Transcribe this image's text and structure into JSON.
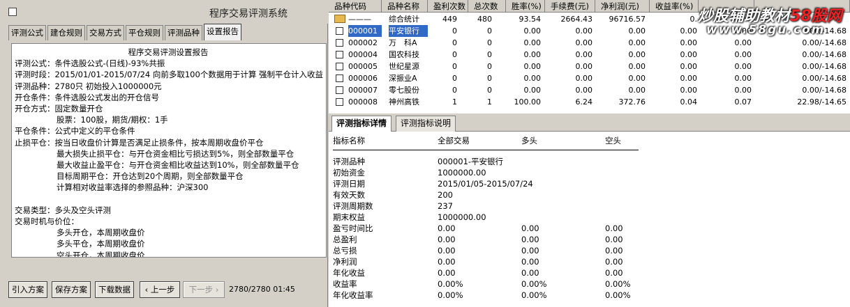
{
  "window": {
    "title": "程序交易评测系统"
  },
  "tabs": [
    "评测公式",
    "建仓规则",
    "交易方式",
    "平仓规则",
    "评测品种",
    "设置报告"
  ],
  "report": {
    "title": "程序交易评测设置报告",
    "lines": [
      "评测公式：条件选股公式-(日线)-93%共振",
      "评测时段：2015/01/01-2015/07/24 向前多取100个数据用于计算 强制平仓计入收益",
      "评测品种：2780只 初始投入1000000元",
      "开仓条件：条件选股公式发出的开仓信号",
      "开仓方式：固定数量开仓",
      "股票：100股，期货/期权：1手",
      "平仓条件：公式中定义的平仓条件",
      "止损平仓：按当日收盘价计算是否满足止损条件，按本周期收盘价平仓",
      "最大损失止损平仓：与开仓资金相比亏损达到5%，则全部数量平仓",
      "最大收益止盈平仓：与开仓资金相比收益达到10%，则全部数量平仓",
      "目标周期平仓：开仓达到20个周期，则全部数量平仓",
      "计算相对收益率选择的参照品种：沪深300",
      "",
      "交易类型：多头及空头评测",
      "交易时机与价位：",
      "多头开仓，本周期收盘价",
      "多头平仓，本周期收盘价",
      "空头开仓，本周期收盘价"
    ]
  },
  "buttons": {
    "import": "引入方案",
    "save": "保存方案",
    "download": "下载数据",
    "prev": "上一步",
    "next": "下一步"
  },
  "status": "2780/2780  01:45",
  "grid": {
    "headers": [
      "品种代码",
      "品种名称",
      "盈利次数",
      "总次数",
      "胜率(%)",
      "手续费(元)",
      "净利润(元)",
      "收益率(%)",
      "",
      ""
    ],
    "rows": [
      {
        "code": "———",
        "name": "综合统计",
        "win": "449",
        "total": "480",
        "rate": "93.54",
        "fee": "2664.43",
        "profit": "96716.57",
        "ret": "0.",
        "c9": "",
        "c10": "",
        "folder": true
      },
      {
        "code": "000001",
        "name": "平安银行",
        "win": "0",
        "total": "0",
        "rate": "0.00",
        "fee": "0.00",
        "profit": "0.00",
        "ret": "0.00",
        "c9": "0.00",
        "c10": "0.00/-14.68",
        "selected": true
      },
      {
        "code": "000002",
        "name": "万　科A",
        "win": "0",
        "total": "0",
        "rate": "0.00",
        "fee": "0.00",
        "profit": "0.00",
        "ret": "0.00",
        "c9": "0.00",
        "c10": "0.00/-14.68"
      },
      {
        "code": "000004",
        "name": "国农科技",
        "win": "0",
        "total": "0",
        "rate": "0.00",
        "fee": "0.00",
        "profit": "0.00",
        "ret": "0.00",
        "c9": "0.00",
        "c10": "0.00/-14.68"
      },
      {
        "code": "000005",
        "name": "世纪星源",
        "win": "0",
        "total": "0",
        "rate": "0.00",
        "fee": "0.00",
        "profit": "0.00",
        "ret": "0.00",
        "c9": "0.00",
        "c10": "0.00/-14.68"
      },
      {
        "code": "000006",
        "name": "深振业A",
        "win": "0",
        "total": "0",
        "rate": "0.00",
        "fee": "0.00",
        "profit": "0.00",
        "ret": "0.00",
        "c9": "0.00",
        "c10": "0.00/-14.68"
      },
      {
        "code": "000007",
        "name": "零七股份",
        "win": "0",
        "total": "0",
        "rate": "0.00",
        "fee": "0.00",
        "profit": "0.00",
        "ret": "0.00",
        "c9": "0.00",
        "c10": "0.00/-14.68"
      },
      {
        "code": "000008",
        "name": "神州高铁",
        "win": "1",
        "total": "1",
        "rate": "100.00",
        "fee": "6.24",
        "profit": "372.76",
        "ret": "0.04",
        "c9": "0.07",
        "c10": "22.98/-14.65"
      }
    ]
  },
  "indicator_tabs": [
    "评测指标详情",
    "评测指标说明"
  ],
  "indicators": {
    "headers": [
      "指标名称",
      "全部交易",
      "多头",
      "空头"
    ],
    "rows": [
      [
        "评测品种",
        "000001-平安银行",
        "",
        ""
      ],
      [
        "初始资金",
        "1000000.00",
        "",
        ""
      ],
      [
        "评测日期",
        "2015/01/05-2015/07/24",
        "",
        ""
      ],
      [
        "有效天数",
        "200",
        "",
        ""
      ],
      [
        "评测周期数",
        "237",
        "",
        ""
      ],
      [
        "期末权益",
        "1000000.00",
        "",
        ""
      ],
      [
        "盈亏时间比",
        "0.00",
        "0.00",
        "0.00"
      ],
      [
        "总盈利",
        "0.00",
        "0.00",
        "0.00"
      ],
      [
        "总亏损",
        "0.00",
        "0.00",
        "0.00"
      ],
      [
        "净利润",
        "0.00",
        "0.00",
        "0.00"
      ],
      [
        "年化收益",
        "0.00",
        "0.00",
        "0.00"
      ],
      [
        "收益率",
        "0.00%",
        "0.00%",
        "0.00%"
      ],
      [
        "年化收益率",
        "0.00%",
        "0.00%",
        "0.00%"
      ]
    ]
  },
  "watermark": {
    "line1_main": "炒股辅助教材",
    "line1_accent": "58股网",
    "line2": "www.58gu.com"
  }
}
